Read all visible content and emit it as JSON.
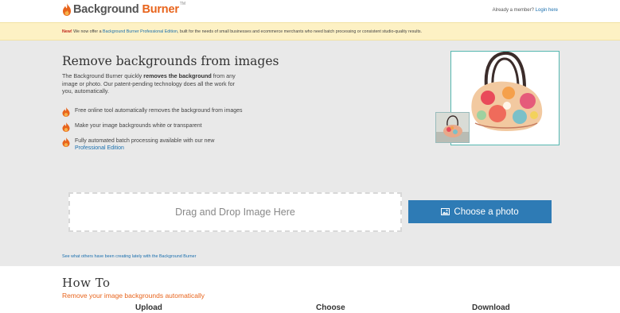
{
  "header": {
    "logo_text_1": "Background",
    "logo_text_2": "Burner",
    "logo_tm": "TM",
    "member_prompt": "Already a member?",
    "login_link": "Login here"
  },
  "announcement": {
    "new_label": "New!",
    "text_before": " We now offer a ",
    "link_text": "Background Burner Professional Edition",
    "text_after": ", built for the needs of small businesses and ecommerce merchants who need batch processing or consistent studio-quality results."
  },
  "hero": {
    "title": "Remove backgrounds from images",
    "desc_1": "The Background Burner quickly ",
    "desc_bold": "removes the background",
    "desc_2": " from any image or photo. Our patent-pending technology does all the work for you, automatically.",
    "features": [
      {
        "text": "Free online tool automatically removes the background from images",
        "link": ""
      },
      {
        "text": "Make your image backgrounds white or transparent",
        "link": ""
      },
      {
        "text": "Fully automated batch processing available with our new ",
        "link": "Professional Edition"
      }
    ]
  },
  "upload": {
    "dropzone_text": "Drag and Drop Image Here",
    "choose_button": "Choose a photo",
    "see_others": "See what others have been creating lately with the Background Burner"
  },
  "howto": {
    "title": "How To",
    "subtitle": "Remove your image backgrounds automatically",
    "steps": [
      "Upload",
      "Choose",
      "Download"
    ]
  },
  "colors": {
    "accent": "#e8641c",
    "link": "#1a6fae",
    "button": "#2e7bb5",
    "banner": "#fdf1c4"
  }
}
